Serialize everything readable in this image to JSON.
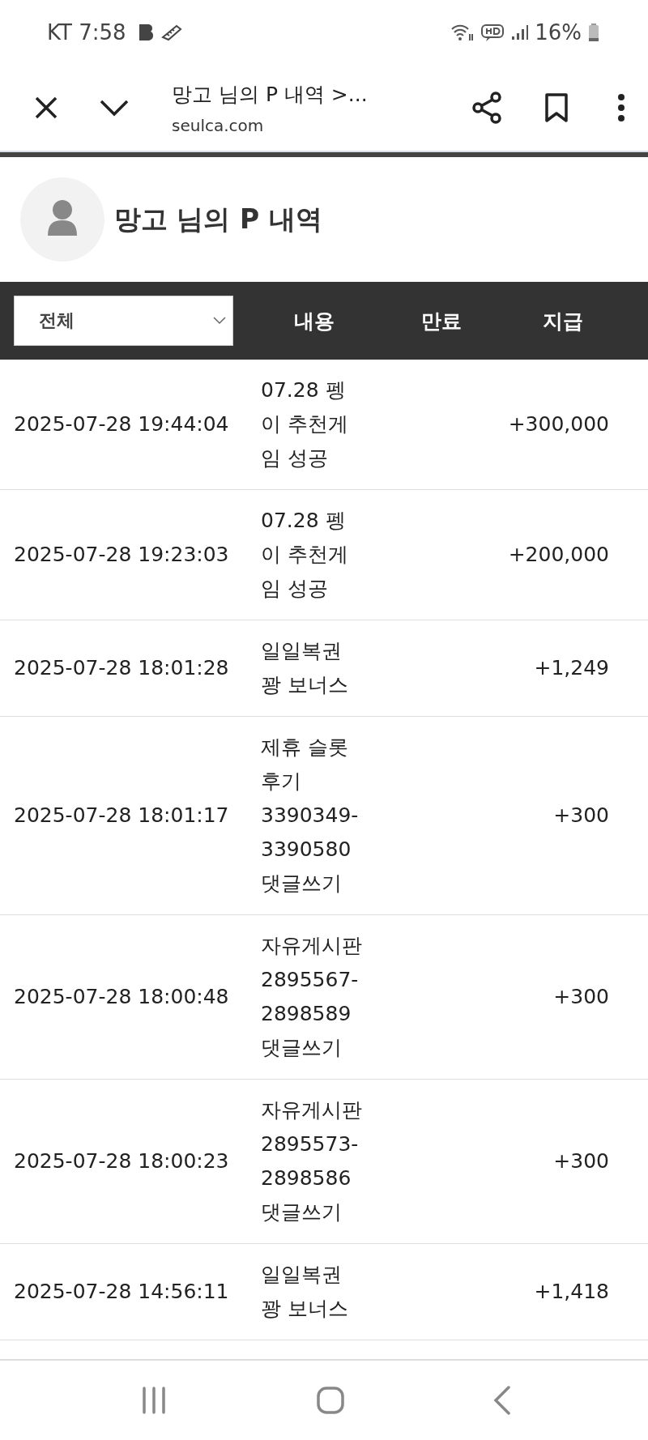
{
  "status_bar": {
    "carrier_time": "KT 7:58",
    "battery": "16%"
  },
  "browser": {
    "title": "망고 님의 P 내역 >...",
    "url": "seulca.com"
  },
  "profile": {
    "title": "망고 님의 P 내역"
  },
  "table": {
    "filter": {
      "value": "전체"
    },
    "columns": [
      "내용",
      "만료",
      "지급"
    ],
    "rows": [
      {
        "date": "2025-07-28 19:44:04",
        "content": [
          "07.28 펭",
          "이 추천게",
          "임 성공"
        ],
        "amount": "+300,000"
      },
      {
        "date": "2025-07-28 19:23:03",
        "content": [
          "07.28 펭",
          "이 추천게",
          "임 성공"
        ],
        "amount": "+200,000"
      },
      {
        "date": "2025-07-28 18:01:28",
        "content": [
          "일일복권",
          "꽝 보너스"
        ],
        "amount": "+1,249"
      },
      {
        "date": "2025-07-28 18:01:17",
        "content": [
          "제휴 슬롯",
          "후기",
          "3390349-",
          "3390580",
          "댓글쓰기"
        ],
        "amount": "+300"
      },
      {
        "date": "2025-07-28 18:00:48",
        "content": [
          "자유게시판",
          "2895567-",
          "2898589",
          "댓글쓰기"
        ],
        "amount": "+300"
      },
      {
        "date": "2025-07-28 18:00:23",
        "content": [
          "자유게시판",
          "2895573-",
          "2898586",
          "댓글쓰기"
        ],
        "amount": "+300"
      },
      {
        "date": "2025-07-28 14:56:11",
        "content": [
          "일일복권",
          "꽝 보너스"
        ],
        "amount": "+1,418"
      }
    ]
  }
}
